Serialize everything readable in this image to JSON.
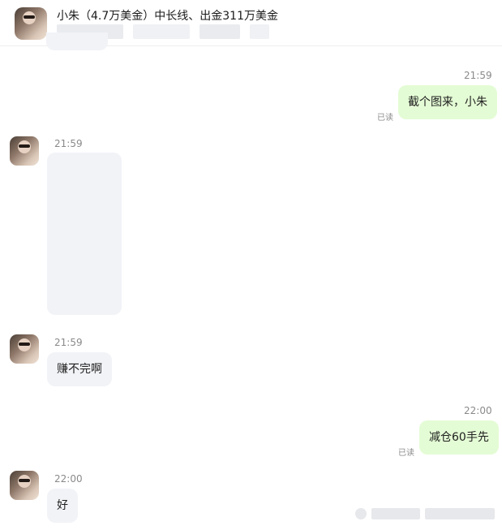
{
  "header": {
    "title": "小朱（4.7万美金）中长线、出金311万美金"
  },
  "messages": [
    {
      "id": "m1",
      "side": "out",
      "time": "21:59",
      "text": "截个图来，小朱",
      "read": "已读"
    },
    {
      "id": "m2",
      "side": "in",
      "time": "21:59",
      "kind": "image"
    },
    {
      "id": "m3",
      "side": "in",
      "time": "21:59",
      "text": "赚不完啊"
    },
    {
      "id": "m4",
      "side": "out",
      "time": "22:00",
      "text": "减仓60手先",
      "read": "已读"
    },
    {
      "id": "m5",
      "side": "in",
      "time": "22:00",
      "text": "好"
    }
  ]
}
